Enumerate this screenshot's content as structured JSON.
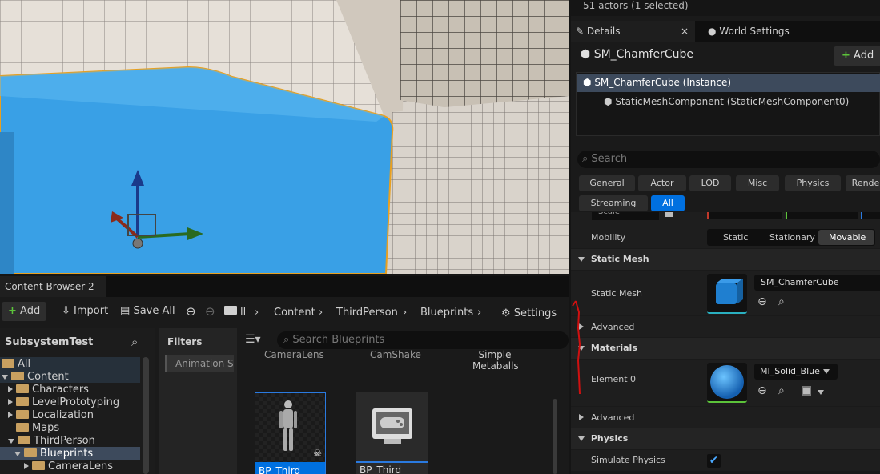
{
  "details": {
    "actor_count": "51 actors (1 selected)",
    "tab_details": "Details",
    "tab_world_settings": "World Settings",
    "object_name": "SM_ChamferCube",
    "add_label": "Add",
    "components": [
      {
        "label": "SM_ChamferCube (Instance)"
      },
      {
        "label": "StaticMeshComponent (StaticMeshComponent0)"
      }
    ],
    "search_placeholder": "Search",
    "categories": [
      "General",
      "Actor",
      "LOD",
      "Misc",
      "Physics",
      "Rende",
      "Streaming",
      "All"
    ],
    "scale_label": "Scale",
    "mobility_label": "Mobility",
    "mobility_options": [
      "Static",
      "Stationary",
      "Movable"
    ],
    "sections": {
      "static_mesh": "Static Mesh",
      "materials": "Materials",
      "physics": "Physics",
      "advanced": "Advanced"
    },
    "static_mesh_label": "Static Mesh",
    "static_mesh_value": "SM_ChamferCube",
    "element0_label": "Element 0",
    "element0_value": "MI_Solid_Blue",
    "simulate_physics_label": "Simulate Physics",
    "simulate_physics_checked": true
  },
  "content_browser": {
    "tab_label": "Content Browser 2",
    "add_label": "Add",
    "import_label": "Import",
    "save_all_label": "Save All",
    "breadcrumbs": [
      "ll",
      "Content",
      "ThirdPerson",
      "Blueprints"
    ],
    "settings_label": "Settings",
    "tree_root": "SubsystemTest",
    "filters_label": "Filters",
    "filter_chip": "Animation S",
    "search_placeholder": "Search Blueprints",
    "tree": [
      {
        "label": "All"
      },
      {
        "label": "Content"
      },
      {
        "label": "Characters"
      },
      {
        "label": "LevelPrototyping"
      },
      {
        "label": "Localization"
      },
      {
        "label": "Maps"
      },
      {
        "label": "ThirdPerson"
      },
      {
        "label": "Blueprints"
      },
      {
        "label": "CameraLens"
      }
    ],
    "top_assets": [
      "CameraLens",
      "CamShake",
      "Simple Metaballs"
    ],
    "assets": [
      {
        "label": "BP_Third"
      },
      {
        "label": "BP_Third"
      }
    ]
  },
  "colors": {
    "accent": "#0070e0",
    "selection": "#3d4a5c",
    "selected_outline": "#e8a020",
    "cube": "#39a0e6"
  }
}
